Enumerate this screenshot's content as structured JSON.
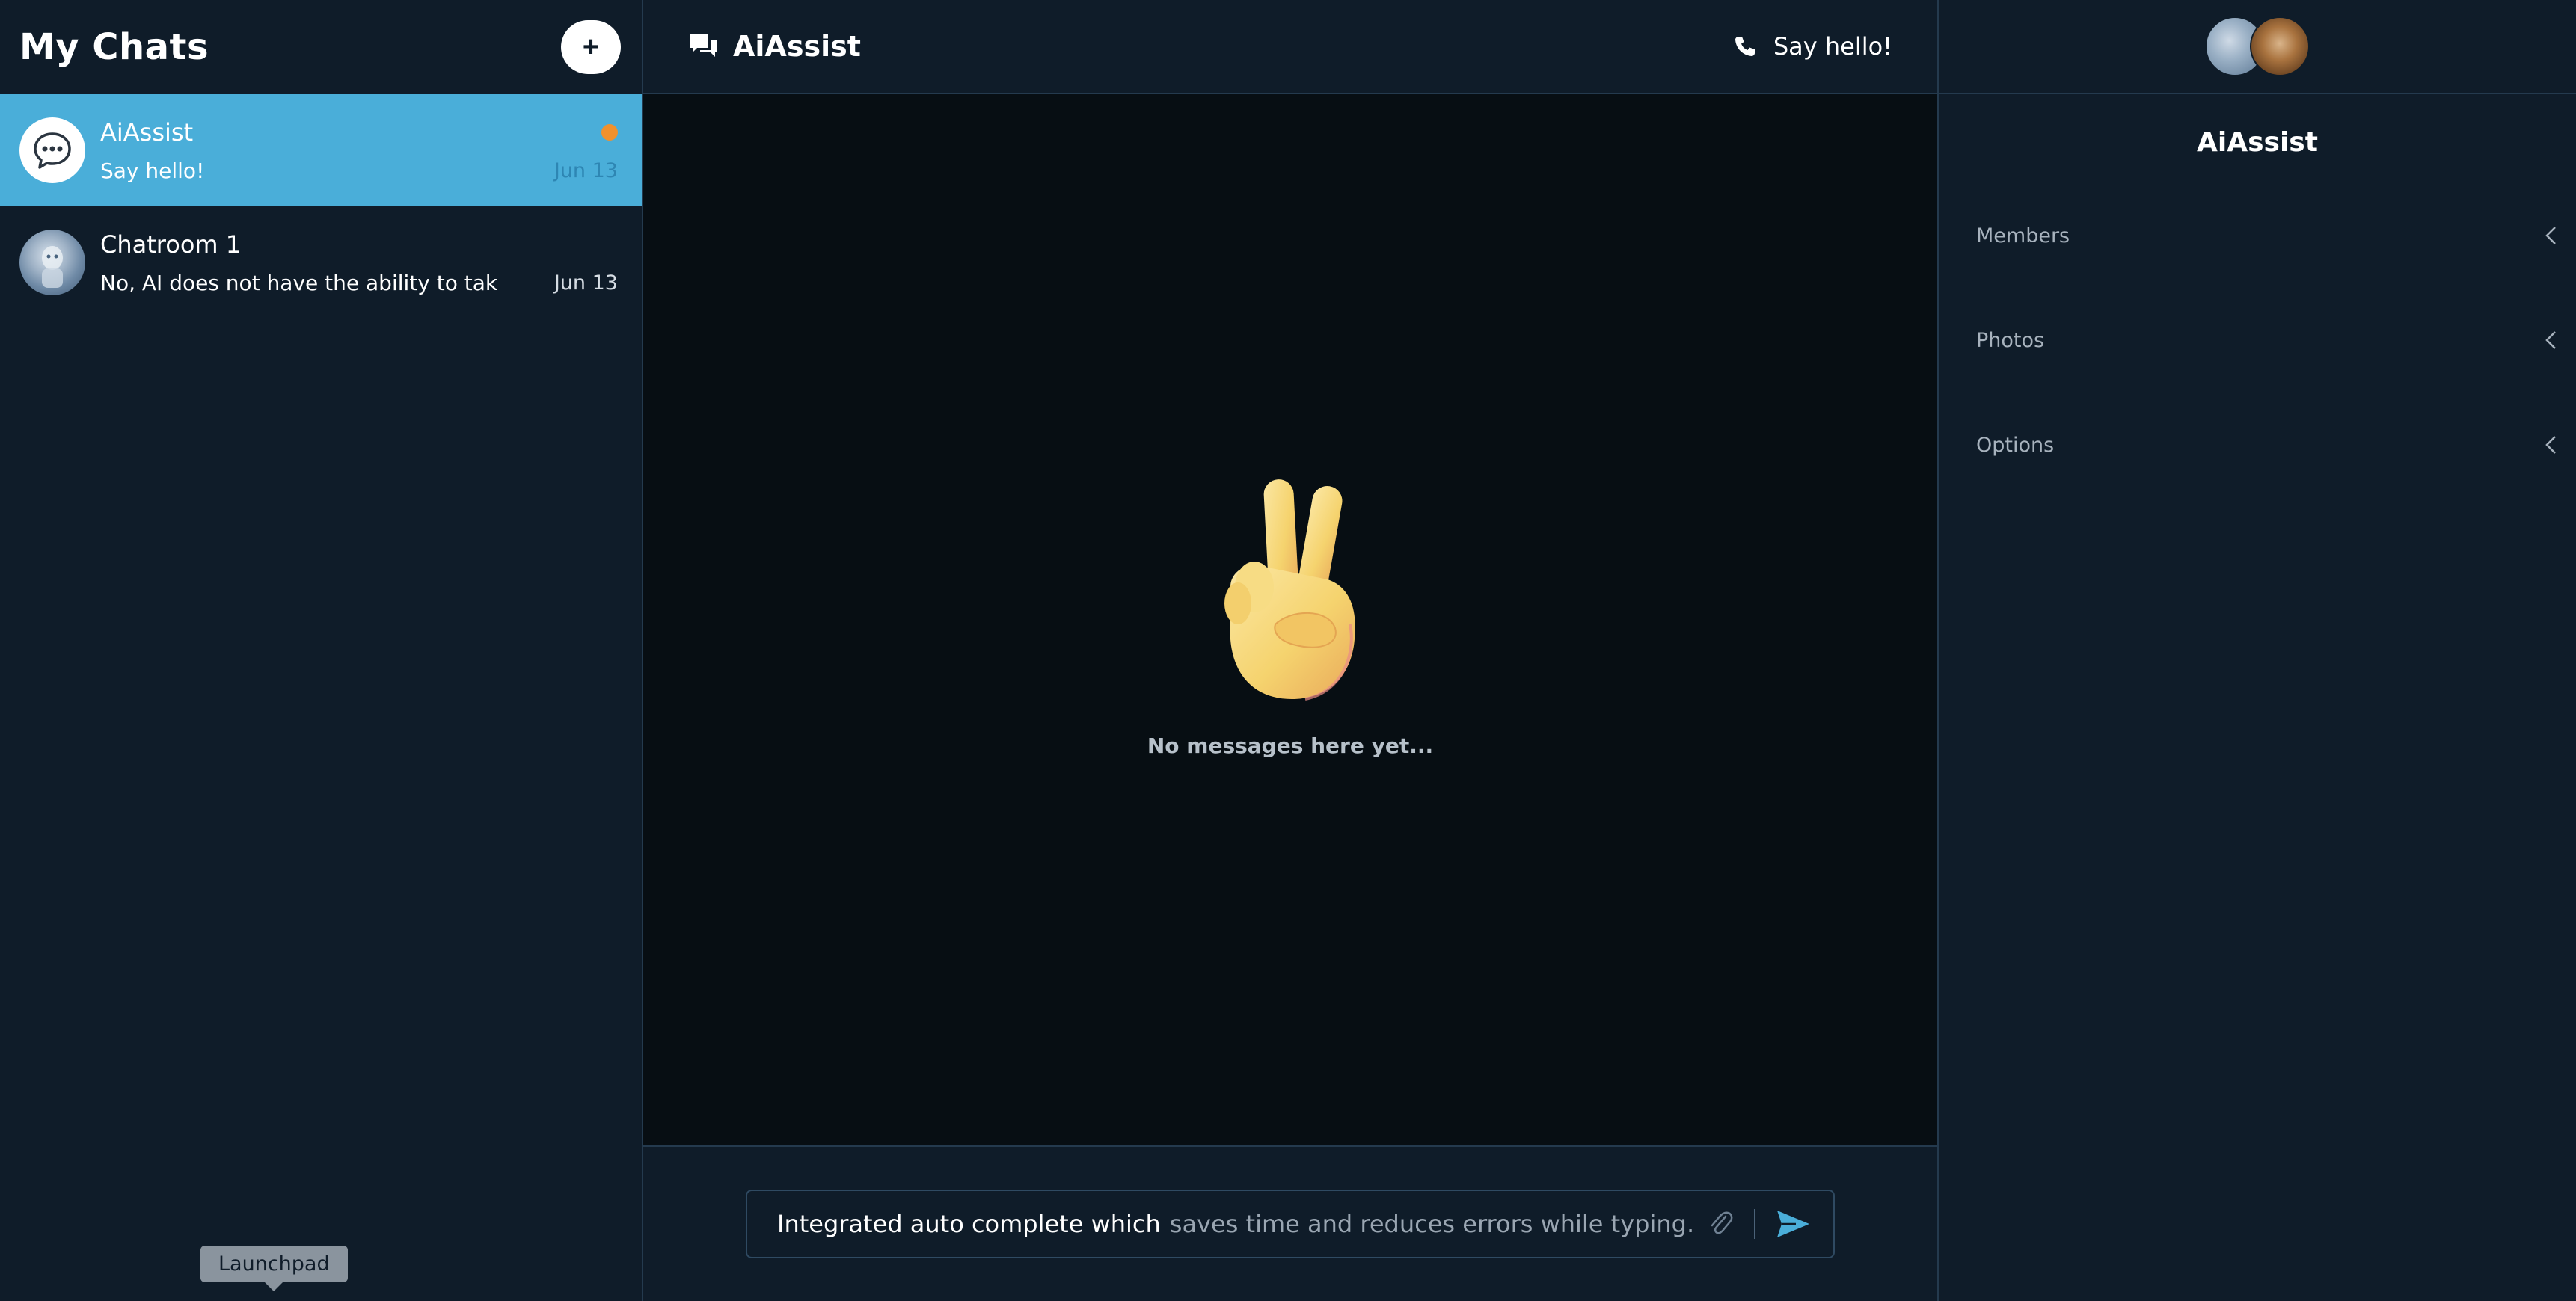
{
  "sidebar": {
    "title": "My Chats",
    "new_chat_label": "+",
    "chats": [
      {
        "name": "AiAssist",
        "preview": "Say hello!",
        "date": "Jun 13",
        "unread": true,
        "active": true
      },
      {
        "name": "Chatroom 1",
        "preview": "No, AI does not have the ability to tak",
        "date": "Jun 13",
        "unread": false,
        "active": false
      }
    ],
    "tooltip": "Launchpad"
  },
  "header": {
    "title": "AiAssist",
    "call_label": "Say hello!"
  },
  "messages": {
    "empty_text": "No messages here yet..."
  },
  "composer": {
    "typed_text": "Integrated auto complete which",
    "suggestion_text": "saves time and reduces errors while typing."
  },
  "details": {
    "title": "AiAssist",
    "sections": [
      {
        "label": "Members"
      },
      {
        "label": "Photos"
      },
      {
        "label": "Options"
      }
    ]
  },
  "colors": {
    "accent": "#4aaed9",
    "unread_dot": "#f0912d",
    "background": "#0f1c29",
    "messages_background": "#070e13"
  },
  "icons": {
    "new_chat": "plus-icon",
    "header": "chat-bubbles-icon",
    "call": "phone-icon",
    "attach": "paperclip-icon",
    "send": "send-icon",
    "section": "chevron-left-icon",
    "empty_state": "victory-hand-emoji"
  }
}
